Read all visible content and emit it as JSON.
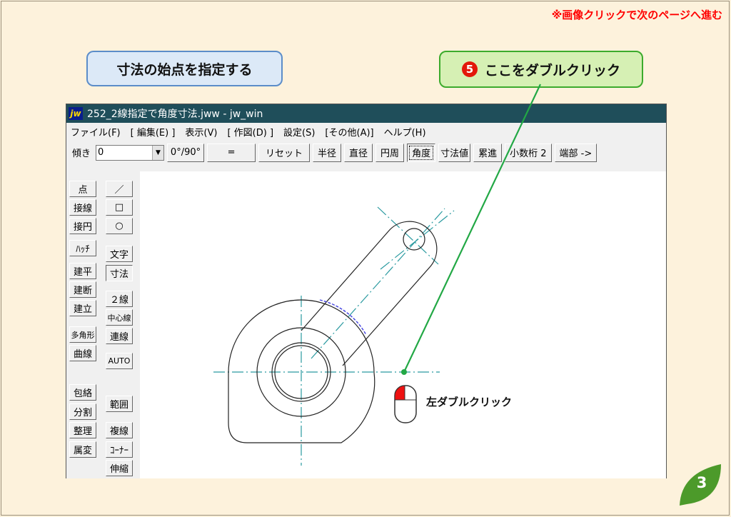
{
  "top_note": "※画像クリックで次のページへ進む",
  "callouts": {
    "left": "寸法の始点を指定する",
    "right_step": "5",
    "right": "ここをダブルクリック"
  },
  "window": {
    "logo": "jw",
    "title": "252_2線指定で角度寸法.jww - jw_win",
    "menu": [
      "ファイル(F)",
      "[ 編集(E) ]",
      "表示(V)",
      "[ 作図(D) ]",
      "設定(S)",
      "[その他(A)]",
      "ヘルプ(H)"
    ],
    "toolbar": {
      "tilt_label": "傾き",
      "tilt_value": "0",
      "buttons": [
        "0°/90°",
        "=",
        "リセット",
        "半径",
        "直径",
        "円周",
        "角度",
        "寸法値",
        "累進",
        "小数桁 2",
        "端部 ->"
      ],
      "pressed": "角度"
    },
    "left_col1": [
      "点",
      "接線",
      "接円",
      "ﾊｯﾁ",
      "建平",
      "建断",
      "建立",
      "多角形",
      "曲線",
      "包絡",
      "分割",
      "整理",
      "属変"
    ],
    "left_col2": [
      "／",
      "□",
      "○",
      "文字",
      "寸法",
      "２線",
      "中心線",
      "連線",
      "AUTO",
      "範囲",
      "複線",
      "ｺｰﾅｰ",
      "伸縮"
    ],
    "left_pressed": "寸法"
  },
  "mouse_label": "左ダブルクリック",
  "page_number": "3",
  "colors": {
    "note_red": "#ff0000",
    "callout_blue_fill": "#dce9f7",
    "callout_green_fill": "#d6f0b4",
    "leader_green": "#22a845",
    "centerline_teal": "#2a9aa0",
    "arc_blue": "#3f3fe0",
    "titlebar": "#1f4e5a",
    "leaf_green": "#4c9a2a"
  }
}
